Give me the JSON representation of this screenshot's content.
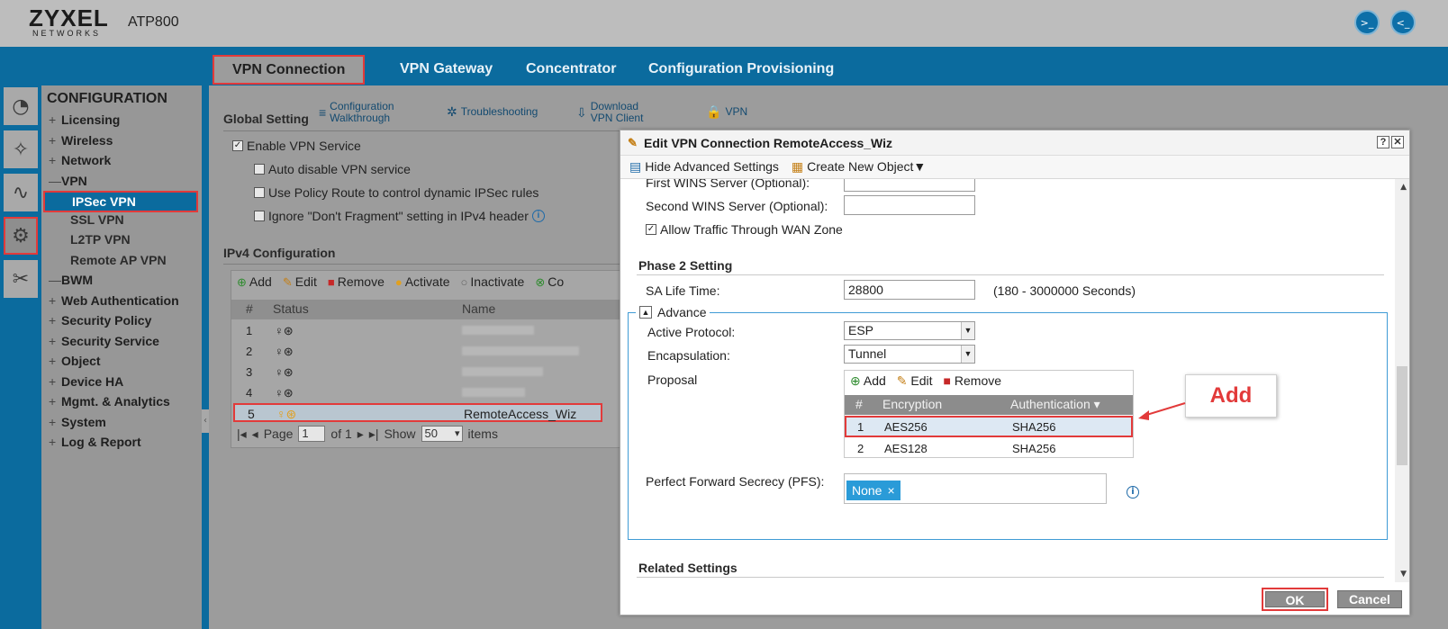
{
  "header": {
    "brand": "ZYXEL",
    "brand_sub": "NETWORKS",
    "model": "ATP800",
    "icons": [
      "console-icon",
      "cli-icon"
    ]
  },
  "tabs": [
    {
      "label": "VPN Connection",
      "active": true
    },
    {
      "label": "VPN Gateway",
      "active": false
    },
    {
      "label": "Concentrator",
      "active": false
    },
    {
      "label": "Configuration Provisioning",
      "active": false
    }
  ],
  "rail": [
    {
      "icon": "dashboard-icon"
    },
    {
      "icon": "monitor-icon"
    },
    {
      "icon": "traffic-icon"
    },
    {
      "icon": "gear-icon",
      "active": true
    },
    {
      "icon": "tools-icon"
    }
  ],
  "tree": {
    "title": "CONFIGURATION",
    "items": [
      {
        "sym": "+",
        "label": "Licensing"
      },
      {
        "sym": "+",
        "label": "Wireless"
      },
      {
        "sym": "+",
        "label": "Network"
      },
      {
        "sym": "—",
        "label": "VPN"
      },
      {
        "sym": "—",
        "label": "BWM"
      },
      {
        "sym": "+",
        "label": "Web Authentication"
      },
      {
        "sym": "+",
        "label": "Security Policy"
      },
      {
        "sym": "+",
        "label": "Security Service"
      },
      {
        "sym": "+",
        "label": "Object"
      },
      {
        "sym": "+",
        "label": "Device HA"
      },
      {
        "sym": "+",
        "label": "Mgmt. & Analytics"
      },
      {
        "sym": "+",
        "label": "System"
      },
      {
        "sym": "+",
        "label": "Log & Report"
      }
    ],
    "vpn_sub": [
      {
        "label": "IPSec VPN",
        "active": true
      },
      {
        "label": "SSL VPN"
      },
      {
        "label": "L2TP VPN"
      },
      {
        "label": "Remote AP VPN"
      }
    ]
  },
  "main": {
    "global_setting": "Global Setting",
    "quick_links": [
      {
        "label": "Configuration Walkthrough",
        "line1": "Configuration",
        "line2": "Walkthrough",
        "icon": "walkthrough-icon"
      },
      {
        "label": "Troubleshooting",
        "line1": "Troubleshooting",
        "line2": "",
        "icon": "troubleshoot-icon"
      },
      {
        "label": "Download VPN Client",
        "line1": "Download",
        "line2": "VPN Client",
        "icon": "download-icon"
      },
      {
        "label": "VPN",
        "line1": "VPN",
        "line2": "",
        "icon": "lock-icon"
      }
    ],
    "enable_vpn": "Enable VPN Service",
    "auto_disable": "Auto disable VPN service",
    "policy_route": "Use Policy Route to control dynamic IPSec rules",
    "ignore_df": "Ignore \"Don't Fragment\" setting in IPv4 header",
    "ipv4_config": "IPv4 Configuration",
    "grid_toolbar": [
      "Add",
      "Edit",
      "Remove",
      "Activate",
      "Inactivate",
      "Co"
    ],
    "grid_columns": [
      "#",
      "Status",
      "Name"
    ],
    "grid_rows": [
      {
        "num": "1",
        "name": ""
      },
      {
        "num": "2",
        "name": ""
      },
      {
        "num": "3",
        "name": ""
      },
      {
        "num": "4",
        "name": ""
      },
      {
        "num": "5",
        "name": "RemoteAccess_Wiz"
      }
    ],
    "pager": {
      "page_label": "Page",
      "page_value": "1",
      "of": "of 1",
      "show": "Show",
      "per_page": "50",
      "items": "items"
    }
  },
  "dialog": {
    "title": "Edit VPN Connection RemoteAccess_Wiz",
    "hide_advanced": "Hide Advanced Settings",
    "create_object": "Create New Object▼",
    "first_wins": "First WINS Server (Optional):",
    "second_wins": "Second WINS Server (Optional):",
    "allow_wan": "Allow Traffic Through WAN Zone",
    "phase2": "Phase 2 Setting",
    "sa_life_label": "SA Life Time:",
    "sa_life_value": "28800",
    "sa_life_range": "(180 - 3000000 Seconds)",
    "advance": "Advance",
    "active_protocol_label": "Active Protocol:",
    "active_protocol_value": "ESP",
    "encapsulation_label": "Encapsulation:",
    "encapsulation_value": "Tunnel",
    "proposal_label": "Proposal",
    "proposal_toolbar": [
      "Add",
      "Edit",
      "Remove"
    ],
    "proposal_columns": [
      "#",
      "Encryption",
      "Authentication ▾"
    ],
    "proposal_rows": [
      {
        "num": "1",
        "enc": "AES256",
        "auth": "SHA256"
      },
      {
        "num": "2",
        "enc": "AES128",
        "auth": "SHA256"
      }
    ],
    "pfs_label": "Perfect Forward Secrecy (PFS):",
    "pfs_value": "None",
    "pfs_remove": "×",
    "related": "Related Settings",
    "ok": "OK",
    "cancel": "Cancel",
    "help": "?",
    "close": "✕"
  },
  "callout": {
    "text": "Add"
  },
  "colors": {
    "accent_blue": "#0b6b9e",
    "highlight_red": "#e23a3a",
    "chip_blue": "#2a9bd8"
  }
}
